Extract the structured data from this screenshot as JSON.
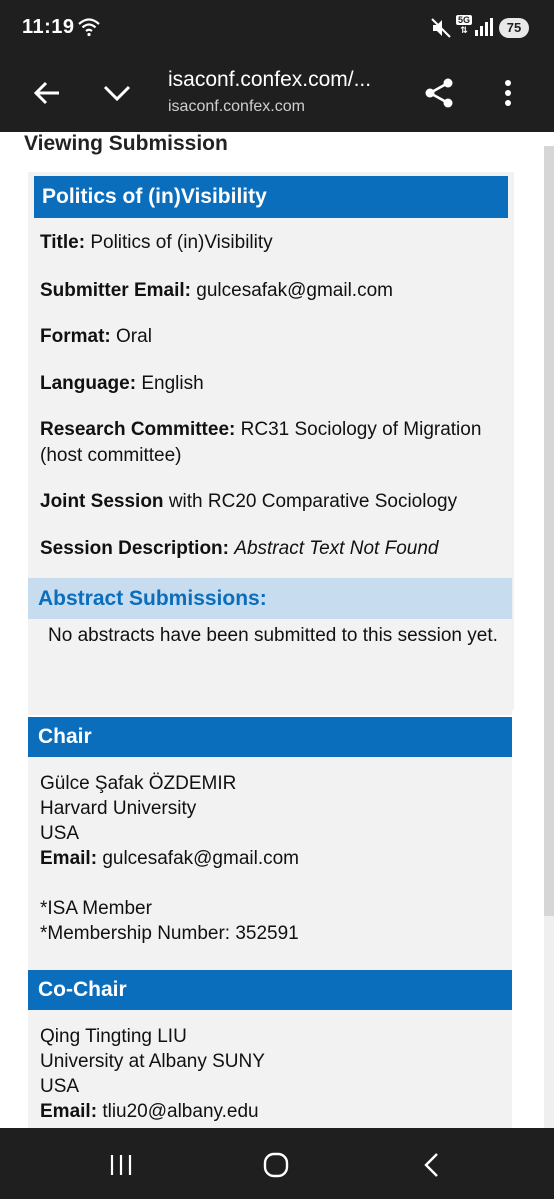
{
  "status_bar": {
    "time": "11:19",
    "network": "5G",
    "battery": "75"
  },
  "toolbar": {
    "url_title": "isaconf.confex.com/...",
    "url_domain": "isaconf.confex.com"
  },
  "page": {
    "title": "Viewing Submission",
    "session": {
      "header": "Politics of (in)Visibility",
      "title_label": "Title:",
      "title_value": "Politics of (in)Visibility",
      "email_label": "Submitter Email:",
      "email_value": "gulcesafak@gmail.com",
      "format_label": "Format:",
      "format_value": "Oral",
      "language_label": "Language:",
      "language_value": "English",
      "committee_label": "Research Committee:",
      "committee_value": "RC31 Sociology of Migration (host committee)",
      "joint_label": "Joint Session",
      "joint_value": "with RC20 Comparative Sociology",
      "description_label": "Session Description:",
      "description_value": "Abstract Text Not Found"
    },
    "abstracts": {
      "header": "Abstract Submissions:",
      "text": "No abstracts have been submitted to this session yet."
    },
    "chair": {
      "header": "Chair",
      "name": "Gülce Şafak ÖZDEMIR",
      "institution": "Harvard University",
      "country": "USA",
      "email_label": "Email:",
      "email_value": "gulcesafak@gmail.com",
      "member": "*ISA Member",
      "membership": "*Membership Number: 352591"
    },
    "cochair": {
      "header": "Co-Chair",
      "name": "Qing Tingting LIU",
      "institution": "University at Albany SUNY",
      "country": "USA",
      "email_label": "Email:",
      "email_value": "tliu20@albany.edu"
    }
  },
  "colors": {
    "header_blue": "#0a6ebd",
    "abstract_bg": "#c7dcef",
    "panel_bg": "#f2f2f2",
    "bar_bg": "#1f1f1f"
  }
}
